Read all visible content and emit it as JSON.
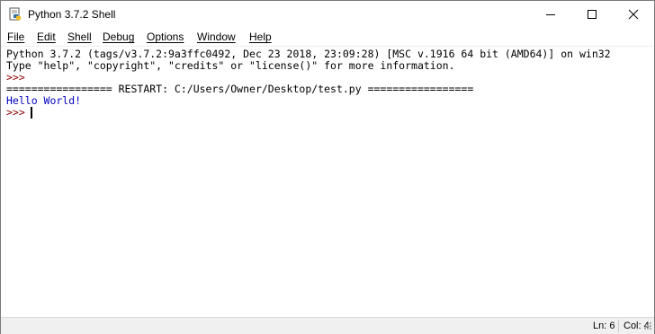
{
  "window": {
    "title": "Python 3.7.2 Shell",
    "icon": "python-idle-icon"
  },
  "menu": {
    "items": [
      "File",
      "Edit",
      "Shell",
      "Debug",
      "Options",
      "Window",
      "Help"
    ]
  },
  "shell": {
    "lines": [
      {
        "text": "Python 3.7.2 (tags/v3.7.2:9a3ffc0492, Dec 23 2018, 23:09:28) [MSC v.1916 64 bit (AMD64)] on win32",
        "kind": "output"
      },
      {
        "text": "Type \"help\", \"copyright\", \"credits\" or \"license()\" for more information.",
        "kind": "output"
      },
      {
        "text": ">>> ",
        "kind": "prompt"
      },
      {
        "text": "================= RESTART: C:/Users/Owner/Desktop/test.py =================",
        "kind": "output"
      },
      {
        "text": "Hello World!",
        "kind": "stdout"
      },
      {
        "text": ">>> ",
        "kind": "prompt"
      }
    ]
  },
  "status": {
    "line": "Ln: 6",
    "col": "Col: 4"
  },
  "colors": {
    "prompt": "#8b0000",
    "stdout": "#0000c0",
    "output": "#000000"
  }
}
